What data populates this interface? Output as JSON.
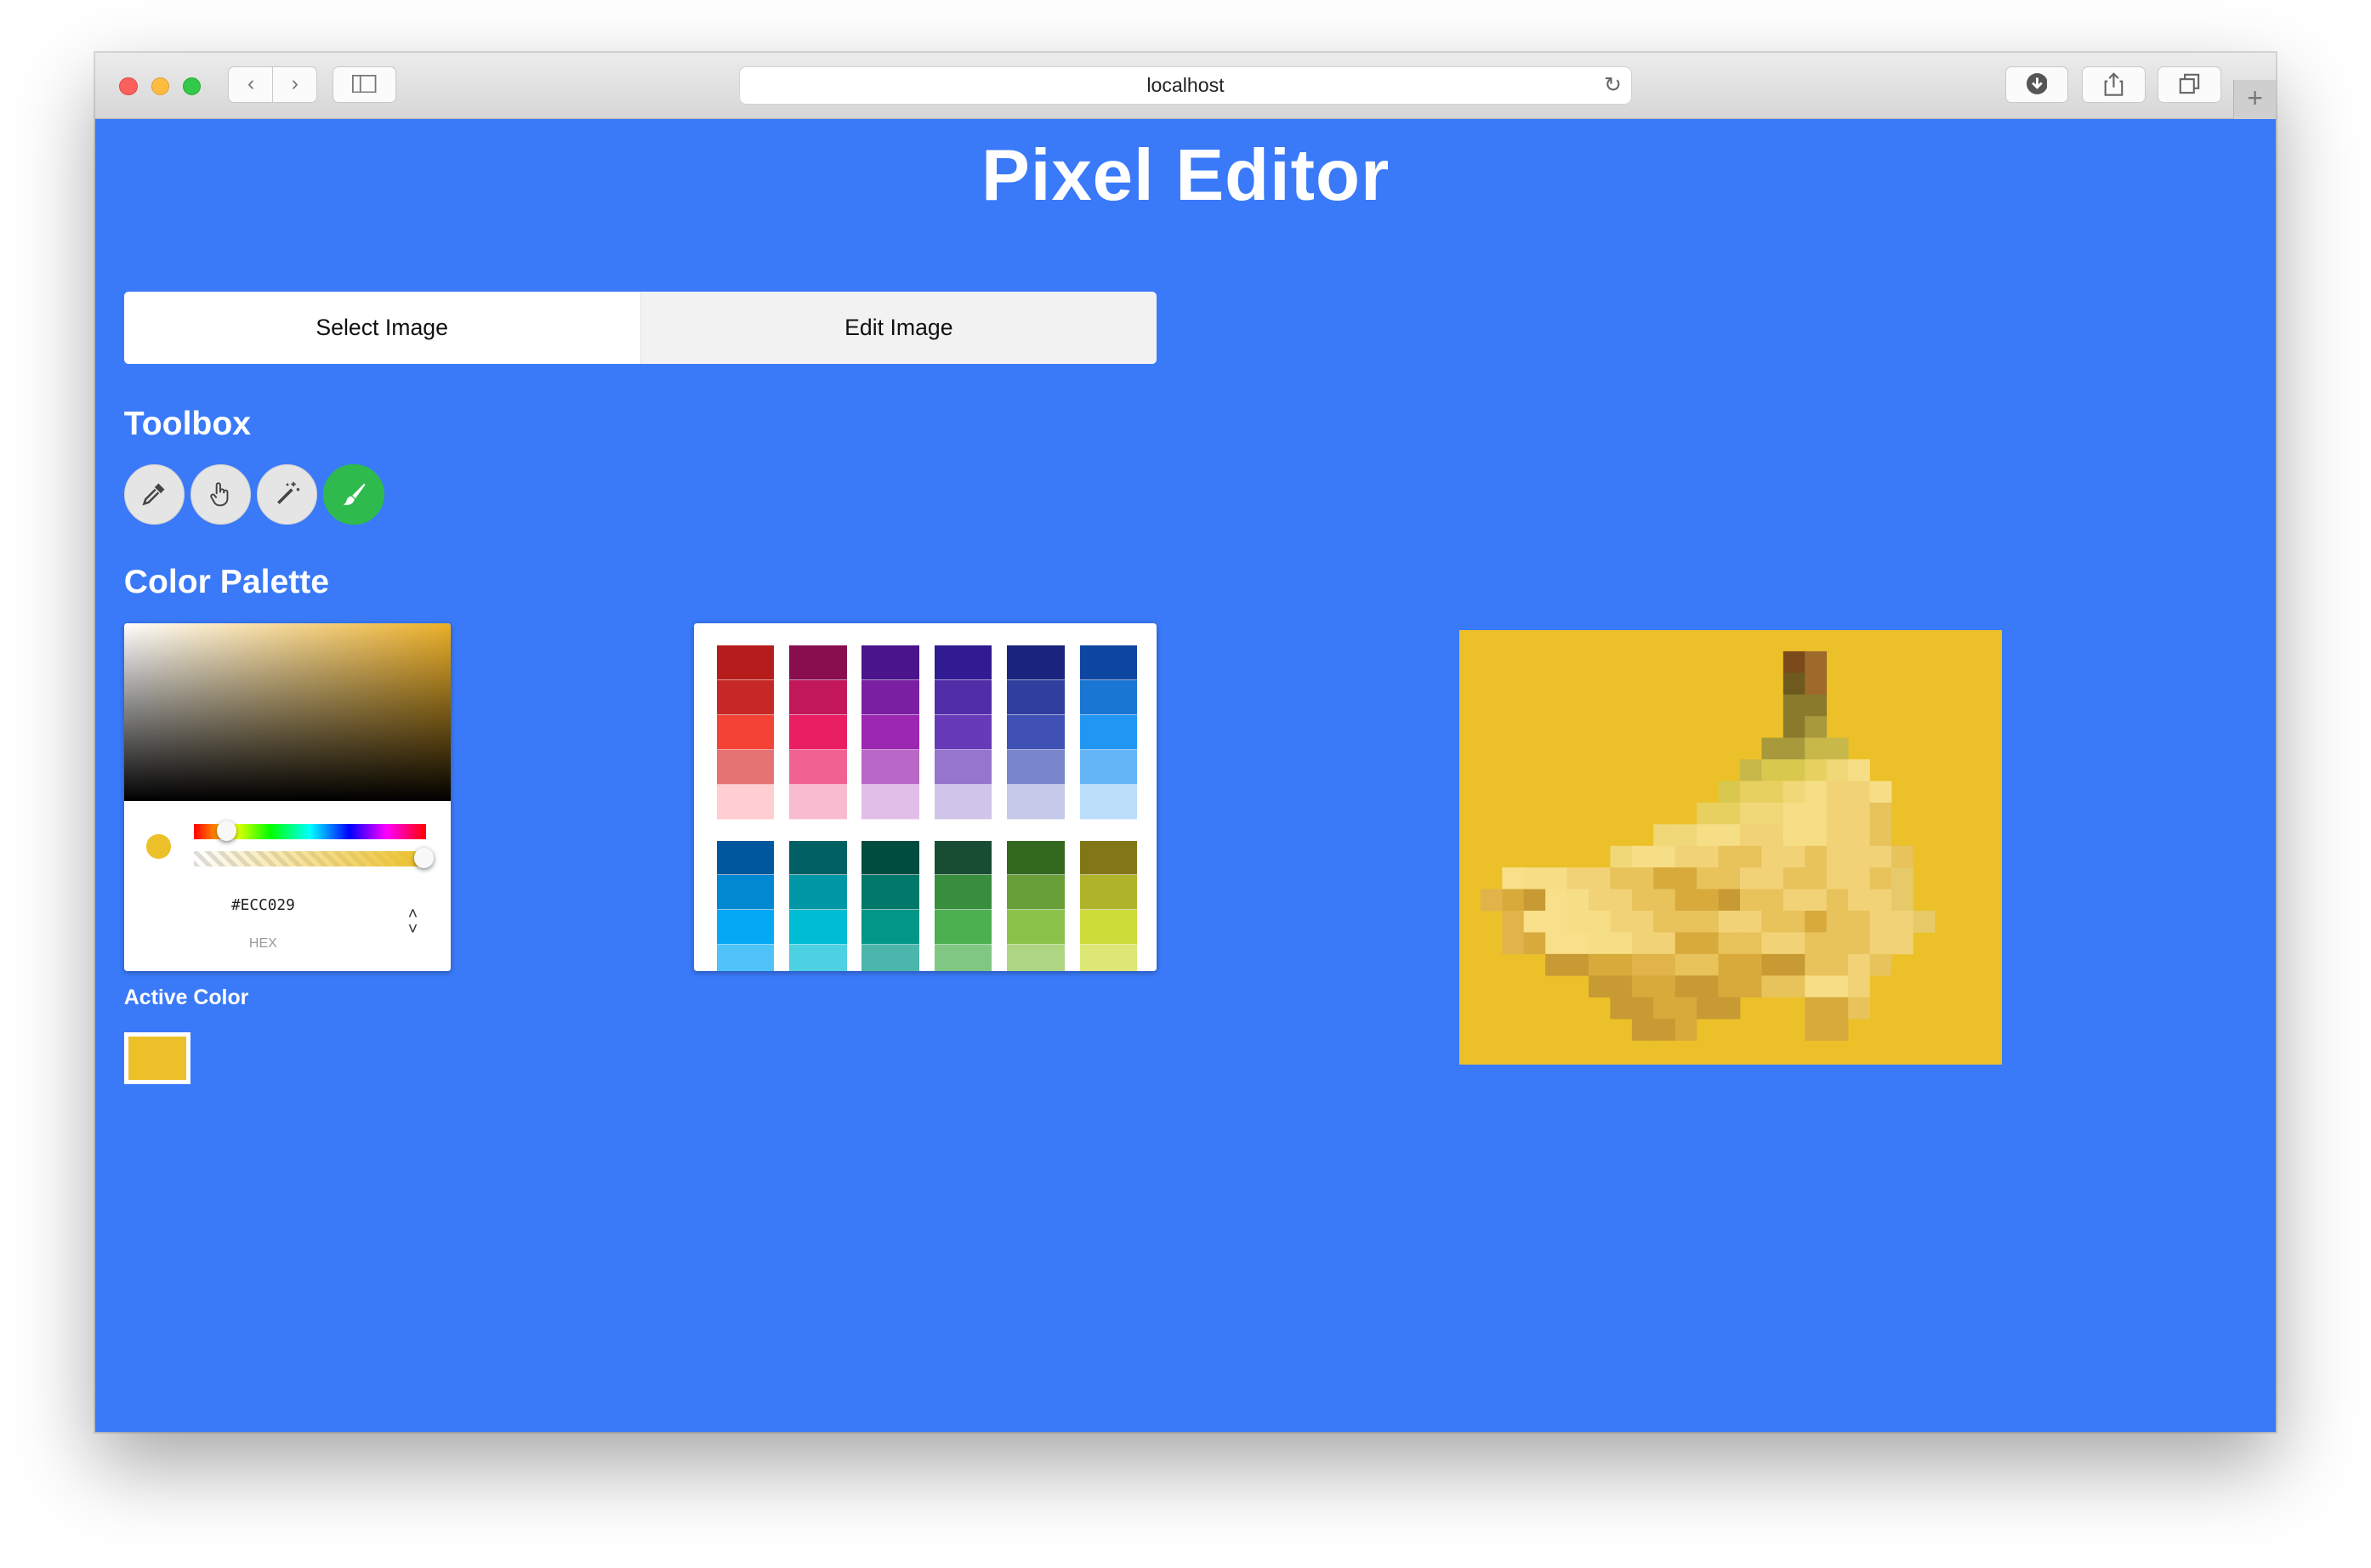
{
  "browser": {
    "url": "localhost"
  },
  "app": {
    "title": "Pixel Editor",
    "tabs": [
      {
        "label": "Select Image"
      },
      {
        "label": "Edit Image"
      }
    ],
    "toolbox": {
      "heading": "Toolbox",
      "tools": [
        {
          "icon": "eyedropper-icon",
          "active": false
        },
        {
          "icon": "hand-pointer-icon",
          "active": false
        },
        {
          "icon": "magic-wand-icon",
          "active": false
        },
        {
          "icon": "paint-brush-icon",
          "active": true
        }
      ]
    },
    "color_palette": {
      "heading": "Color Palette",
      "picker": {
        "hex_value": "#ECC029",
        "format_label": "HEX",
        "hue_position": 0.14,
        "alpha_position": 1.0
      },
      "active_color_label": "Active Color",
      "active_color": "#ecc029"
    },
    "material_palette": [
      [
        "#b71c1c",
        "#c62828",
        "#f44336",
        "#e57373",
        "#ffcdd2"
      ],
      [
        "#880e4f",
        "#c2185b",
        "#e91e63",
        "#f06292",
        "#f8bbd0"
      ],
      [
        "#4a148c",
        "#7b1fa2",
        "#9c27b0",
        "#ba68c8",
        "#e1bee7"
      ],
      [
        "#311b92",
        "#512da8",
        "#673ab7",
        "#9575cd",
        "#d1c4e9"
      ],
      [
        "#1a237e",
        "#303f9f",
        "#3f51b5",
        "#7986cb",
        "#c5cae9"
      ],
      [
        "#0d47a1",
        "#1976d2",
        "#2196f3",
        "#64b5f6",
        "#bbdefb"
      ],
      [
        "#01579b",
        "#0288d1",
        "#03a9f4",
        "#4fc3f7"
      ],
      [
        "#006064",
        "#0097a7",
        "#00bcd4",
        "#4dd0e1"
      ],
      [
        "#004d40",
        "#00796b",
        "#009688",
        "#4db6ac"
      ],
      [
        "#194d33",
        "#388e3c",
        "#4caf50",
        "#81c784"
      ],
      [
        "#33691e",
        "#689f38",
        "#8bc34a",
        "#aed581"
      ],
      [
        "#827717",
        "#afb42b",
        "#cddc39",
        "#dce775"
      ]
    ]
  }
}
